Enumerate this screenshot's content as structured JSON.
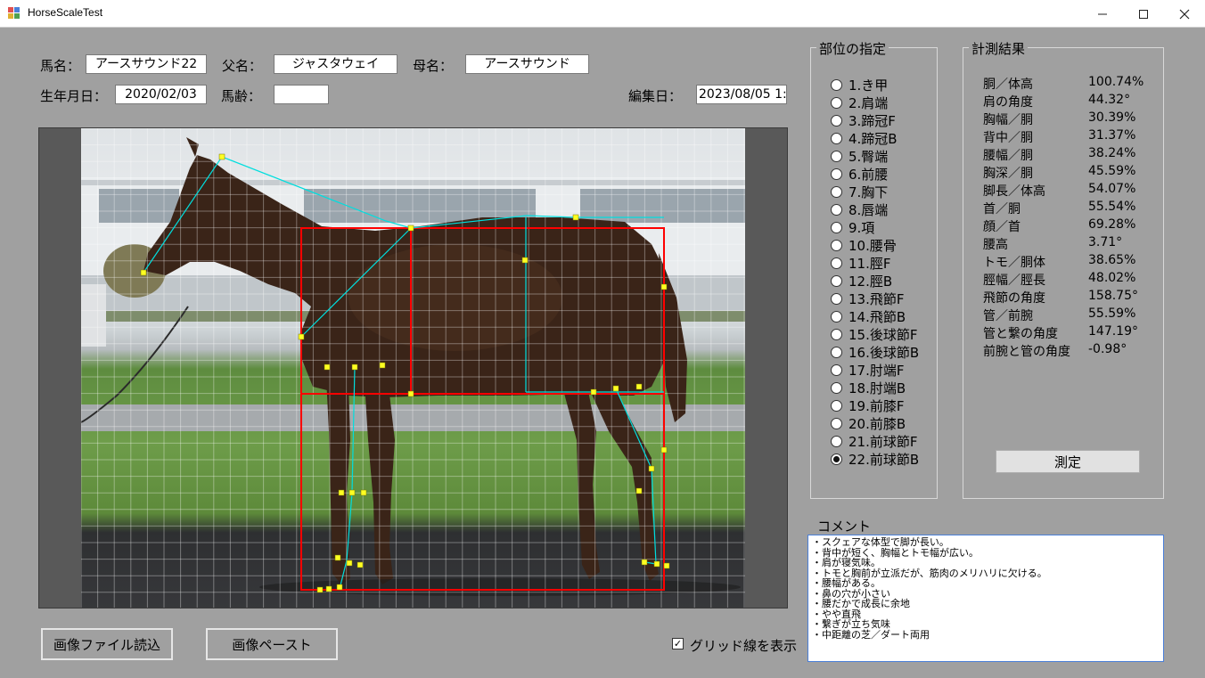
{
  "window": {
    "title": "HorseScaleTest",
    "minimize_icon": "minimize-icon",
    "maximize_icon": "maximize-icon",
    "close_icon": "close-icon"
  },
  "form": {
    "horse_name_label": "馬名：",
    "horse_name_value": "アースサウンド22",
    "sire_label": "父名：",
    "sire_value": "ジャスタウェイ",
    "dam_label": "母名：",
    "dam_value": "アースサウンド",
    "birthdate_label": "生年月日：",
    "birthdate_value": "2020/02/03",
    "age_label": "馬齢：",
    "age_value": "",
    "edit_date_label": "編集日：",
    "edit_date_value": "2023/08/05 1:"
  },
  "buttons": {
    "load_image": "画像ファイル読込",
    "paste_image": "画像ペースト",
    "grid_checkbox_label": "グリッド線を表示",
    "grid_checked": true,
    "measure": "測定"
  },
  "parts_group": {
    "title": "部位の指定",
    "selected_index": 21,
    "items": [
      "1.き甲",
      "2.肩端",
      "3.蹄冠F",
      "4.蹄冠B",
      "5.臀端",
      "6.前腰",
      "7.胸下",
      "8.唇端",
      "9.項",
      "10.腰骨",
      "11.脛F",
      "12.脛B",
      "13.飛節F",
      "14.飛節B",
      "15.後球節F",
      "16.後球節B",
      "17.肘端F",
      "18.肘端B",
      "19.前膝F",
      "20.前膝B",
      "21.前球節F",
      "22.前球節B"
    ]
  },
  "results_group": {
    "title": "計測結果",
    "rows": [
      {
        "key": "胴／体高",
        "value": "100.74%"
      },
      {
        "key": "肩の角度",
        "value": "44.32°"
      },
      {
        "key": "胸幅／胴",
        "value": "30.39%"
      },
      {
        "key": "背中／胴",
        "value": "31.37%"
      },
      {
        "key": "腰幅／胴",
        "value": "38.24%"
      },
      {
        "key": "胸深／胴",
        "value": "45.59%"
      },
      {
        "key": "脚長／体高",
        "value": "54.07%"
      },
      {
        "key": "首／胴",
        "value": "55.54%"
      },
      {
        "key": "顔／首",
        "value": "69.28%"
      },
      {
        "key": "腰高",
        "value": "3.71°"
      },
      {
        "key": "トモ／胴体",
        "value": "38.65%"
      },
      {
        "key": "脛幅／脛長",
        "value": "48.02%"
      },
      {
        "key": "飛節の角度",
        "value": "158.75°"
      },
      {
        "key": "管／前腕",
        "value": "55.59%"
      },
      {
        "key": "管と繋の角度",
        "value": "147.19°"
      },
      {
        "key": "前腕と管の角度",
        "value": "-0.98°"
      }
    ]
  },
  "comment": {
    "label": "コメント",
    "lines": [
      "・スクェアな体型で脚が長い。",
      "・背中が短く、胸幅とトモ幅が広い。",
      "・肩が寝気味。",
      "・トモと胸前が立派だが、筋肉のメリハリに欠ける。",
      "・腰幅がある。",
      "・鼻の穴が小さい",
      "・腰だかで成長に余地",
      "・やや直飛",
      "・繋ぎが立ち気味",
      "・中距離の芝／ダート両用"
    ]
  },
  "colors": {
    "measure_lines": "#ff0000",
    "skeleton_lines": "#00e0e0",
    "markers": "#ffff00",
    "horse_body": "#3a2418"
  }
}
